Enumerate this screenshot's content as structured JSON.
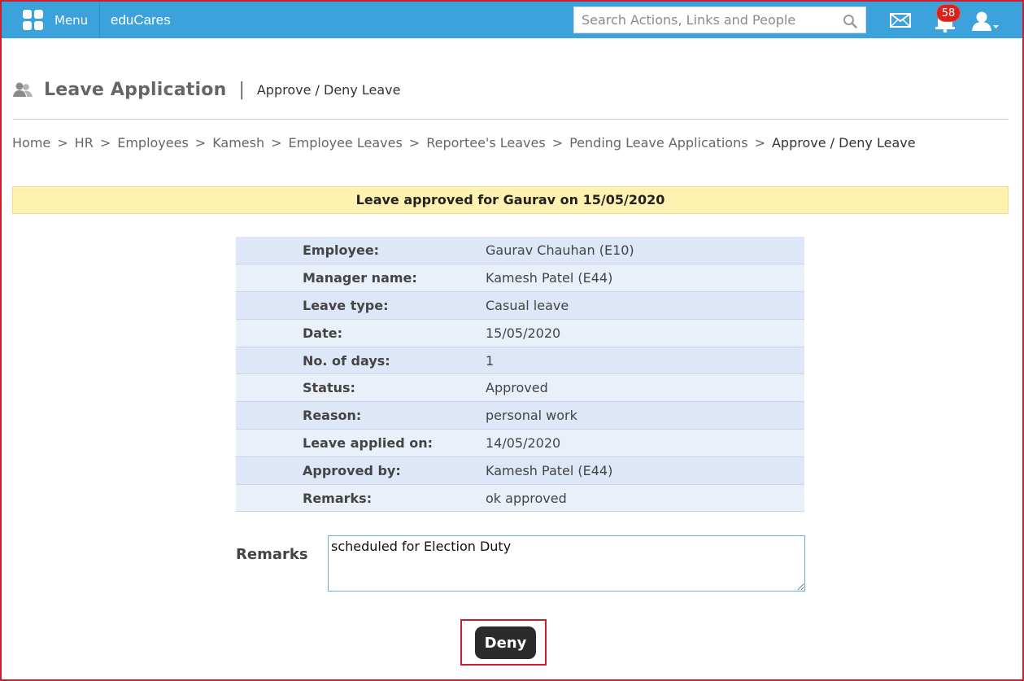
{
  "topbar": {
    "menu_label": "Menu",
    "brand": "eduCares",
    "search_placeholder": "Search Actions, Links and People",
    "notification_count": "58",
    "accent_color": "#3ba2dc"
  },
  "header": {
    "title": "Leave Application",
    "subtitle": "Approve / Deny Leave"
  },
  "breadcrumb": {
    "items": [
      "Home",
      "HR",
      "Employees",
      "Kamesh",
      "Employee Leaves",
      "Reportee's Leaves",
      "Pending Leave Applications"
    ],
    "current": "Approve / Deny Leave"
  },
  "notice": "Leave approved for Gaurav on 15/05/2020",
  "details": [
    {
      "label": "Employee:",
      "value": "Gaurav Chauhan (E10)"
    },
    {
      "label": "Manager name:",
      "value": "Kamesh Patel (E44)"
    },
    {
      "label": "Leave type:",
      "value": "Casual leave"
    },
    {
      "label": "Date:",
      "value": "15/05/2020"
    },
    {
      "label": "No. of days:",
      "value": "1"
    },
    {
      "label": "Status:",
      "value": "Approved"
    },
    {
      "label": "Reason:",
      "value": "personal work"
    },
    {
      "label": "Leave applied on:",
      "value": "14/05/2020"
    },
    {
      "label": "Approved by:",
      "value": "Kamesh Patel (E44)"
    },
    {
      "label": "Remarks:",
      "value": "ok approved"
    }
  ],
  "form": {
    "remarks_label": "Remarks",
    "remarks_value": "scheduled for Election Duty",
    "deny_label": "Deny"
  }
}
